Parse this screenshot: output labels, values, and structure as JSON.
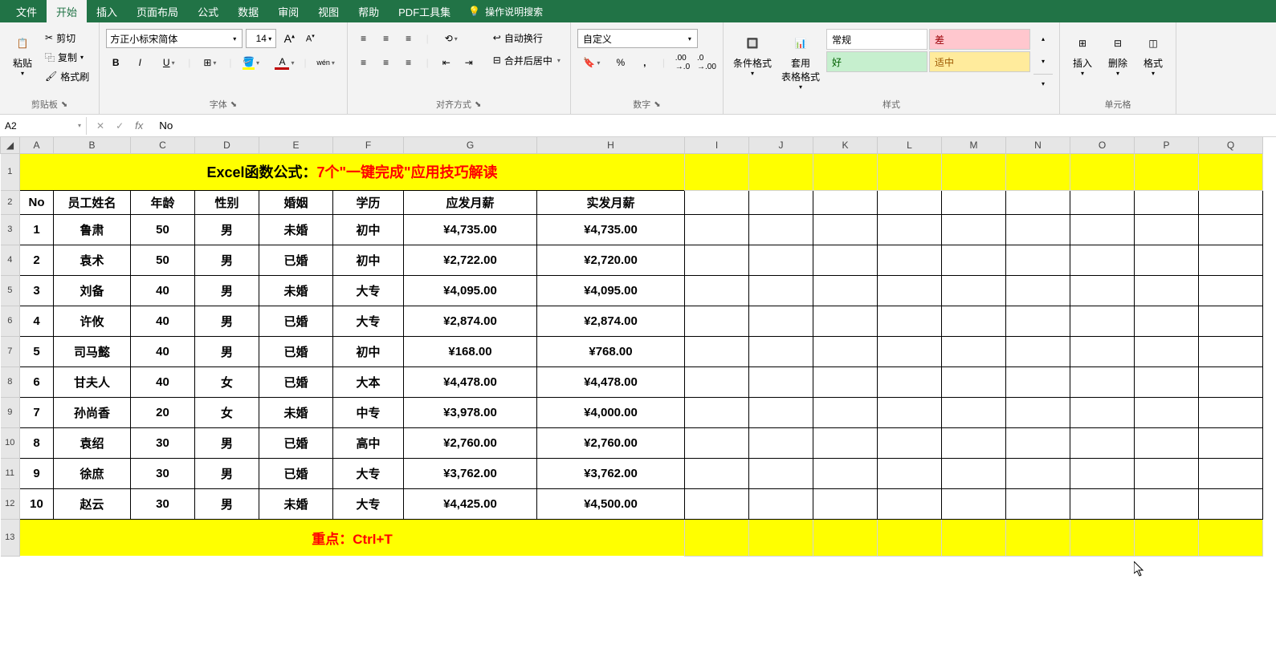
{
  "menu": {
    "items": [
      "文件",
      "开始",
      "插入",
      "页面布局",
      "公式",
      "数据",
      "审阅",
      "视图",
      "帮助",
      "PDF工具集"
    ],
    "active_index": 1,
    "search_placeholder": "操作说明搜索"
  },
  "ribbon": {
    "clipboard": {
      "paste": "粘贴",
      "cut": "剪切",
      "copy": "复制",
      "format_painter": "格式刷",
      "label": "剪贴板"
    },
    "font": {
      "font_name": "方正小标宋简体",
      "font_size": "14",
      "bold": "B",
      "italic": "I",
      "underline": "U",
      "pinyin": "wén",
      "label": "字体"
    },
    "alignment": {
      "wrap_text": "自动换行",
      "merge": "合并后居中",
      "label": "对齐方式"
    },
    "number": {
      "format": "自定义",
      "label": "数字"
    },
    "styles": {
      "conditional": "条件格式",
      "table_format": "套用\n表格格式",
      "normal": "常规",
      "bad": "差",
      "good": "好",
      "neutral": "适中",
      "label": "样式"
    },
    "cells": {
      "insert": "插入",
      "delete": "删除",
      "format": "格式",
      "label": "单元格"
    }
  },
  "formula_bar": {
    "cell_ref": "A2",
    "value": "No"
  },
  "columns": [
    "A",
    "B",
    "C",
    "D",
    "E",
    "F",
    "G",
    "H",
    "I",
    "J",
    "K",
    "L",
    "M",
    "N",
    "O",
    "P",
    "Q"
  ],
  "row_numbers": [
    "1",
    "2",
    "3",
    "4",
    "5",
    "6",
    "7",
    "8",
    "9",
    "10",
    "11",
    "12",
    "13"
  ],
  "title": {
    "black": "Excel函数公式：",
    "red": "7个\"一键完成\"应用技巧解读"
  },
  "headers": [
    "No",
    "员工姓名",
    "年龄",
    "性别",
    "婚姻",
    "学历",
    "应发月薪",
    "实发月薪"
  ],
  "data": [
    {
      "no": "1",
      "name": "鲁肃",
      "age": "50",
      "gender": "男",
      "marriage": "未婚",
      "edu": "初中",
      "gross": "¥4,735.00",
      "net": "¥4,735.00"
    },
    {
      "no": "2",
      "name": "袁术",
      "age": "50",
      "gender": "男",
      "marriage": "已婚",
      "edu": "初中",
      "gross": "¥2,722.00",
      "net": "¥2,720.00"
    },
    {
      "no": "3",
      "name": "刘备",
      "age": "40",
      "gender": "男",
      "marriage": "未婚",
      "edu": "大专",
      "gross": "¥4,095.00",
      "net": "¥4,095.00"
    },
    {
      "no": "4",
      "name": "许攸",
      "age": "40",
      "gender": "男",
      "marriage": "已婚",
      "edu": "大专",
      "gross": "¥2,874.00",
      "net": "¥2,874.00"
    },
    {
      "no": "5",
      "name": "司马懿",
      "age": "40",
      "gender": "男",
      "marriage": "已婚",
      "edu": "初中",
      "gross": "¥168.00",
      "net": "¥768.00"
    },
    {
      "no": "6",
      "name": "甘夫人",
      "age": "40",
      "gender": "女",
      "marriage": "已婚",
      "edu": "大本",
      "gross": "¥4,478.00",
      "net": "¥4,478.00"
    },
    {
      "no": "7",
      "name": "孙尚香",
      "age": "20",
      "gender": "女",
      "marriage": "未婚",
      "edu": "中专",
      "gross": "¥3,978.00",
      "net": "¥4,000.00"
    },
    {
      "no": "8",
      "name": "袁绍",
      "age": "30",
      "gender": "男",
      "marriage": "已婚",
      "edu": "高中",
      "gross": "¥2,760.00",
      "net": "¥2,760.00"
    },
    {
      "no": "9",
      "name": "徐庶",
      "age": "30",
      "gender": "男",
      "marriage": "已婚",
      "edu": "大专",
      "gross": "¥3,762.00",
      "net": "¥3,762.00"
    },
    {
      "no": "10",
      "name": "赵云",
      "age": "30",
      "gender": "男",
      "marriage": "未婚",
      "edu": "大专",
      "gross": "¥4,425.00",
      "net": "¥4,500.00"
    }
  ],
  "footer": {
    "black": "重点：",
    "red": "Ctrl+T"
  }
}
